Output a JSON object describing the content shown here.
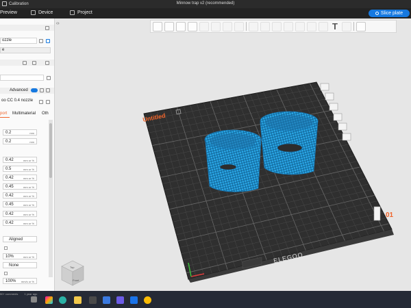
{
  "titlebar": {
    "left_label": "Calibration",
    "title": "Minnow trap v2 (recommended)"
  },
  "nav": {
    "preview": "Preview",
    "device": "Device",
    "project": "Project",
    "slice": "Slice plate"
  },
  "left": {
    "nozzle_label": "ozzle",
    "row2": "e",
    "advanced": "Advanced",
    "profile": "oo CC 0.4 nozzle",
    "tabs": [
      "port",
      "Multimaterial",
      "Oth"
    ],
    "fields": [
      {
        "value": "0.2",
        "unit": "mm"
      },
      {
        "value": "0.2",
        "unit": "mm"
      },
      {
        "value": "0.42",
        "unit": "mm or %"
      },
      {
        "value": "0.5",
        "unit": "mm or %"
      },
      {
        "value": "0.42",
        "unit": "mm or %"
      },
      {
        "value": "0.45",
        "unit": "mm or %"
      },
      {
        "value": "0.42",
        "unit": "mm or %"
      },
      {
        "value": "0.45",
        "unit": "mm or %"
      },
      {
        "value": "0.42",
        "unit": "mm or %"
      },
      {
        "value": "0.42",
        "unit": "mm or %"
      }
    ],
    "aligned": "Aligned",
    "ten_pct": {
      "value": "10%",
      "unit": "mm or %"
    },
    "none": "None",
    "hundred": {
      "value": "100%",
      "unit": "mm/s or %"
    }
  },
  "viewport": {
    "plate_label": "Untitled",
    "plate_number": "01",
    "brand": "ELEGOO",
    "cube_top": "Top",
    "cube_front": "Front"
  },
  "taskbar": {
    "comments": "50+ comments",
    "age": "1 year ago"
  },
  "colors": {
    "accent": "#1679e0",
    "model": "#29a3e0",
    "plate": "#2d2d2d",
    "label_orange": "#f0642a"
  }
}
